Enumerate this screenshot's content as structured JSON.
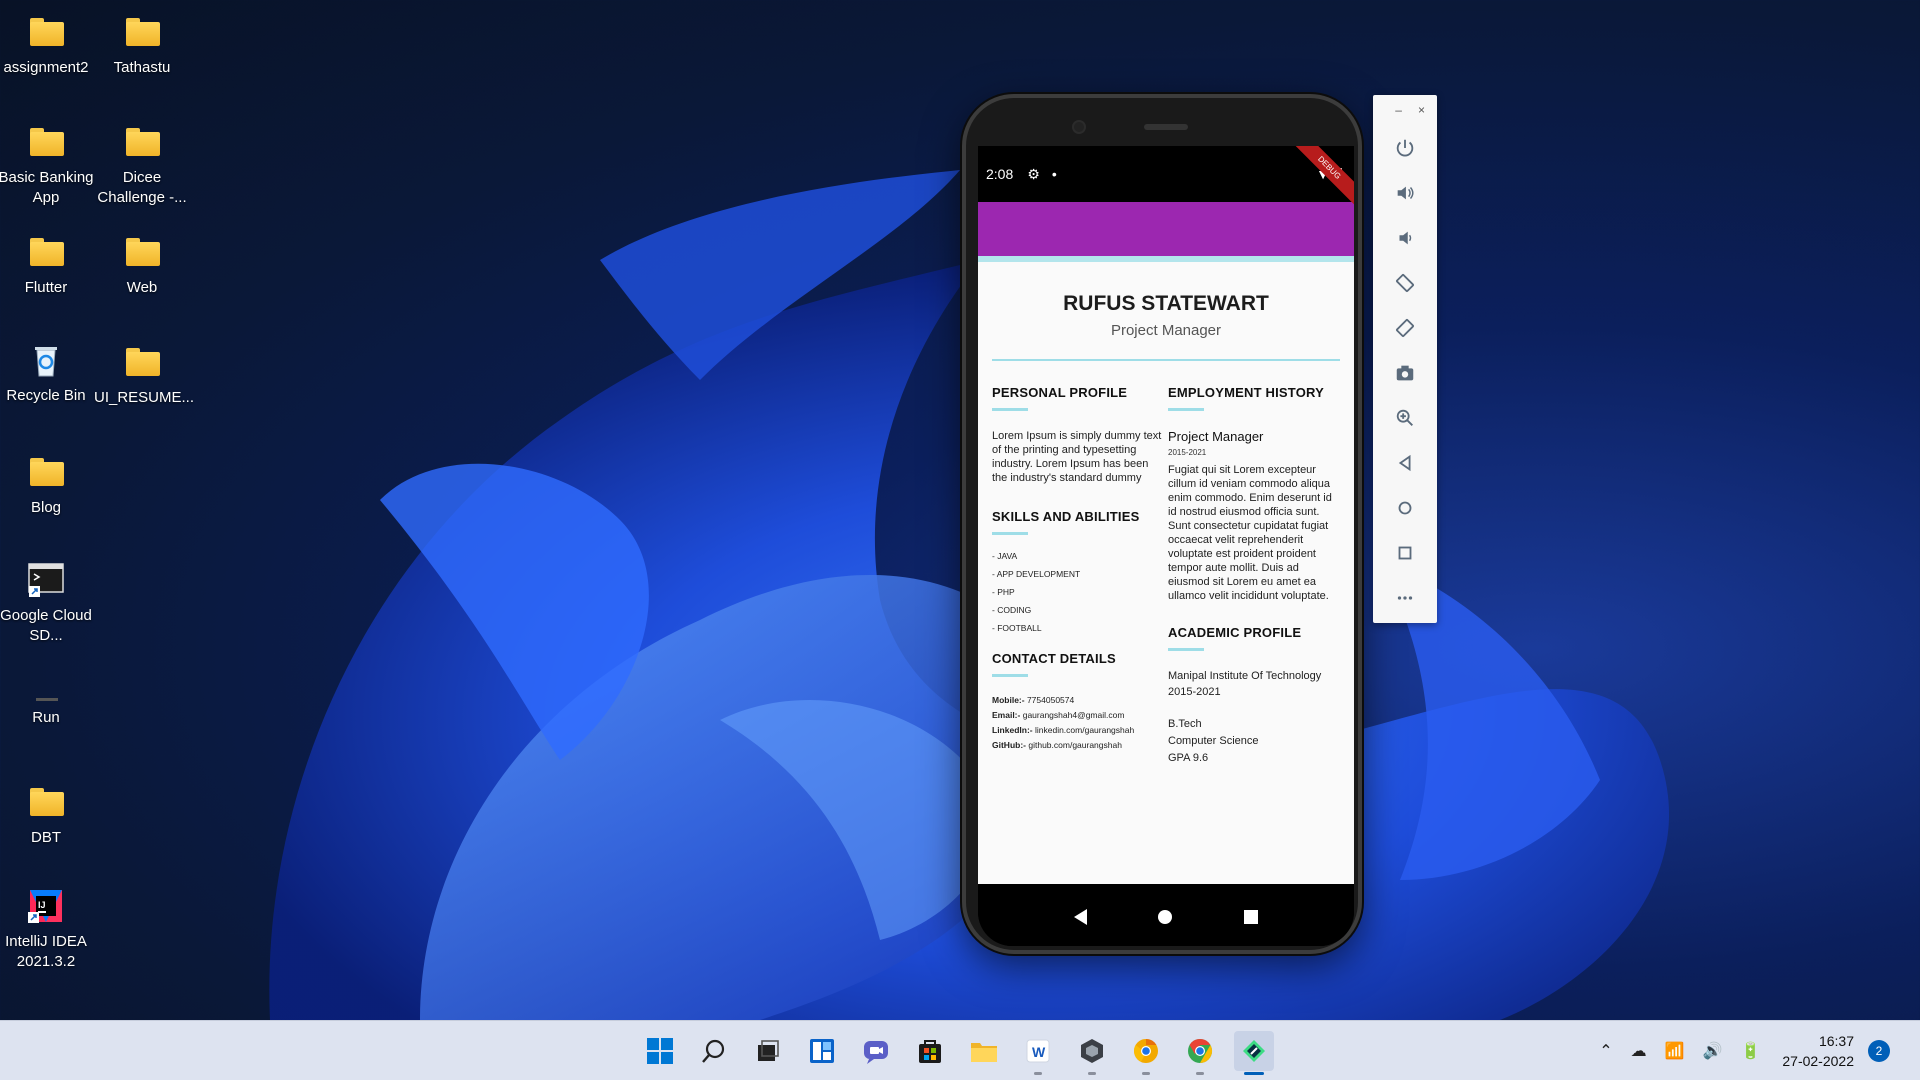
{
  "desktop": {
    "icons": [
      {
        "label": "assignment2",
        "type": "folder"
      },
      {
        "label": "Tathastu",
        "type": "folder"
      },
      {
        "label": "Basic Banking App",
        "type": "folder"
      },
      {
        "label": "Dicee Challenge -...",
        "type": "folder"
      },
      {
        "label": "Flutter",
        "type": "folder"
      },
      {
        "label": "Web",
        "type": "folder"
      },
      {
        "label": "Recycle Bin",
        "type": "recycle-bin"
      },
      {
        "label": "UI_RESUME...",
        "type": "folder"
      },
      {
        "label": "Blog",
        "type": "folder"
      },
      {
        "label": "Google Cloud SD...",
        "type": "shortcut"
      },
      {
        "label": "Run",
        "type": "app"
      },
      {
        "label": "DBT",
        "type": "folder"
      },
      {
        "label": "IntelliJ IDEA 2021.3.2",
        "type": "intellij"
      }
    ]
  },
  "emulator": {
    "status": {
      "time": "2:08",
      "debug_banner": "DEBUG"
    },
    "resume": {
      "name": "RUFUS STATEWART",
      "role": "Project Manager",
      "personal_profile": {
        "title": "PERSONAL PROFILE",
        "text": "Lorem Ipsum is simply dummy text of the printing and typesetting industry. Lorem Ipsum has been the industry's standard dummy"
      },
      "skills": {
        "title": "SKILLS AND ABILITIES",
        "items": [
          "- JAVA",
          "- APP DEVELOPMENT",
          "- PHP",
          "- CODING",
          "- FOOTBALL"
        ]
      },
      "contact": {
        "title": "CONTACT DETAILS",
        "mobile_label": "Mobile:-",
        "mobile": "7754050574",
        "email_label": "Email:-",
        "email": "gaurangshah4@gmail.com",
        "linkedin_label": "LinkedIn:-",
        "linkedin": "linkedin.com/gaurangshah",
        "github_label": "GitHub:-",
        "github": "github.com/gaurangshah"
      },
      "employment": {
        "title": "EMPLOYMENT HISTORY",
        "job_title": "Project Manager",
        "years": "2015-2021",
        "description": "Fugiat qui sit Lorem excepteur cillum id veniam commodo aliqua enim commodo. Enim deserunt id id nostrud eiusmod officia sunt. Sunt consectetur cupidatat fugiat occaecat velit reprehenderit voluptate est proident proident tempor aute mollit. Duis ad eiusmod sit Lorem eu amet ea ullamco velit incididunt voluptate."
      },
      "academic": {
        "title": "ACADEMIC PROFILE",
        "institute": "Manipal Institute Of Technology",
        "years": "2015-2021",
        "degree": "B.Tech",
        "major": "Computer Science",
        "gpa": "GPA 9.6"
      }
    },
    "toolbar": {
      "minimize": "–",
      "close": "×",
      "buttons": [
        "power-icon",
        "volume-up-icon",
        "volume-down-icon",
        "rotate-left-icon",
        "rotate-right-icon",
        "camera-icon",
        "zoom-icon",
        "back-icon",
        "home-icon",
        "overview-icon",
        "more-icon"
      ]
    }
  },
  "taskbar": {
    "apps": [
      "start-icon",
      "search-icon",
      "task-view-icon",
      "widgets-icon",
      "chat-icon",
      "store-icon",
      "file-explorer-icon",
      "word-icon",
      "app-icon",
      "chrome-canary-icon",
      "chrome-icon",
      "android-studio-icon"
    ],
    "clock_time": "16:37",
    "clock_date": "27-02-2022",
    "notification_count": "2"
  },
  "colors": {
    "appbar": "#9c27b0",
    "accent_line": "#9edde7",
    "taskbar": "#dde3f0",
    "windows_accent": "#005fb8"
  }
}
